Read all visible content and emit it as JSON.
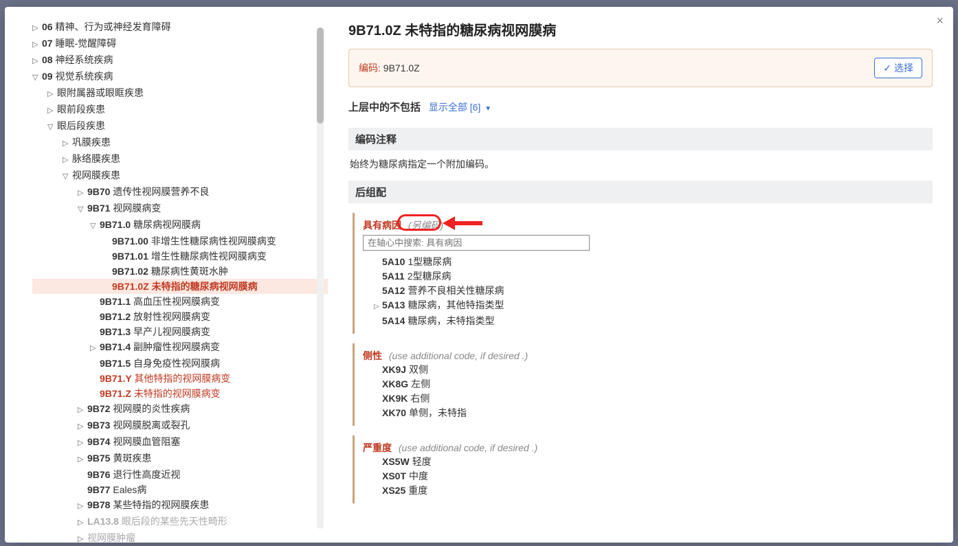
{
  "close_icon": "×",
  "tree": [
    {
      "indent": 0,
      "toggle": "▷",
      "code": "06",
      "text": "精神、行为或神经发育障碍"
    },
    {
      "indent": 0,
      "toggle": "▷",
      "code": "07",
      "text": "睡眠-觉醒障碍"
    },
    {
      "indent": 0,
      "toggle": "▷",
      "code": "08",
      "text": "神经系统疾病"
    },
    {
      "indent": 0,
      "toggle": "▽",
      "code": "09",
      "text": "视觉系统疾病"
    },
    {
      "indent": 1,
      "toggle": "▷",
      "code": "",
      "text": "眼附属器或眼眶疾患"
    },
    {
      "indent": 1,
      "toggle": "▷",
      "code": "",
      "text": "眼前段疾患"
    },
    {
      "indent": 1,
      "toggle": "▽",
      "code": "",
      "text": "眼后段疾患"
    },
    {
      "indent": 2,
      "toggle": "▷",
      "code": "",
      "text": "巩膜疾患"
    },
    {
      "indent": 2,
      "toggle": "▷",
      "code": "",
      "text": "脉络膜疾患"
    },
    {
      "indent": 2,
      "toggle": "▽",
      "code": "",
      "text": "视网膜疾患"
    },
    {
      "indent": 3,
      "toggle": "▷",
      "code": "9B70",
      "text": "遗传性视网膜营养不良"
    },
    {
      "indent": 3,
      "toggle": "▽",
      "code": "9B71",
      "text": "视网膜病变"
    },
    {
      "indent": 4,
      "toggle": "▽",
      "code": "9B71.0",
      "text": "糖尿病视网膜病"
    },
    {
      "indent": 5,
      "toggle": "",
      "code": "9B71.00",
      "text": "非增生性糖尿病性视网膜病变"
    },
    {
      "indent": 5,
      "toggle": "",
      "code": "9B71.01",
      "text": "增生性糖尿病性视网膜病变"
    },
    {
      "indent": 5,
      "toggle": "",
      "code": "9B71.02",
      "text": "糖尿病性黄斑水肿"
    },
    {
      "indent": 5,
      "toggle": "",
      "code": "9B71.0Z",
      "text": "未特指的糖尿病视网膜病",
      "selected": true
    },
    {
      "indent": 4,
      "toggle": "",
      "code": "9B71.1",
      "text": "高血压性视网膜病变"
    },
    {
      "indent": 4,
      "toggle": "",
      "code": "9B71.2",
      "text": "放射性视网膜病变"
    },
    {
      "indent": 4,
      "toggle": "",
      "code": "9B71.3",
      "text": "早产儿视网膜病变"
    },
    {
      "indent": 4,
      "toggle": "▷",
      "code": "9B71.4",
      "text": "副肿瘤性视网膜病变"
    },
    {
      "indent": 4,
      "toggle": "",
      "code": "9B71.5",
      "text": "自身免疫性视网膜病"
    },
    {
      "indent": 4,
      "toggle": "",
      "code": "9B71.Y",
      "text": "其他特指的视网膜病变",
      "highlighted": true
    },
    {
      "indent": 4,
      "toggle": "",
      "code": "9B71.Z",
      "text": "未特指的视网膜病变",
      "highlighted": true
    },
    {
      "indent": 3,
      "toggle": "▷",
      "code": "9B72",
      "text": "视网膜的炎性疾病"
    },
    {
      "indent": 3,
      "toggle": "▷",
      "code": "9B73",
      "text": "视网膜脱离或裂孔"
    },
    {
      "indent": 3,
      "toggle": "▷",
      "code": "9B74",
      "text": "视网膜血管阻塞"
    },
    {
      "indent": 3,
      "toggle": "▷",
      "code": "9B75",
      "text": "黄斑疾患"
    },
    {
      "indent": 3,
      "toggle": "",
      "code": "9B76",
      "text": "退行性高度近视"
    },
    {
      "indent": 3,
      "toggle": "",
      "code": "9B77",
      "text": "Eales病"
    },
    {
      "indent": 3,
      "toggle": "▷",
      "code": "9B78",
      "text": "某些特指的视网膜疾患"
    },
    {
      "indent": 3,
      "toggle": "▷",
      "code": "LA13.8",
      "text": "眼后段的某些先天性畸形",
      "disabled": true
    },
    {
      "indent": 3,
      "toggle": "▷",
      "code": "",
      "text": "视网膜肿瘤",
      "disabled": true
    }
  ],
  "detail": {
    "title": "9B71.0Z 未特指的糖尿病视网膜病",
    "code_label": "编码:",
    "code_value": "9B71.0Z",
    "select_btn": "选择",
    "excludes_label": "上层中的不包括",
    "show_all": "显示全部 [6]",
    "coding_note_header": "编码注释",
    "coding_note_text": "始终为糖尿病指定一个附加编码。",
    "postcoord_header": "后组配",
    "axes": [
      {
        "label": "具有病因",
        "note": "(另编码)",
        "highlight": true,
        "search_placeholder": "在轴心中搜索: 具有病因",
        "items": [
          {
            "toggle": "",
            "code": "5A10",
            "text": "1型糖尿病"
          },
          {
            "toggle": "",
            "code": "5A11",
            "text": "2型糖尿病"
          },
          {
            "toggle": "",
            "code": "5A12",
            "text": "营养不良相关性糖尿病"
          },
          {
            "toggle": "▷",
            "code": "5A13",
            "text": "糖尿病，其他特指类型"
          },
          {
            "toggle": "",
            "code": "5A14",
            "text": "糖尿病，未特指类型"
          }
        ]
      },
      {
        "label": "侧性",
        "note": "(use additional code, if desired .)",
        "items": [
          {
            "code": "XK9J",
            "text": "双侧"
          },
          {
            "code": "XK8G",
            "text": "左侧"
          },
          {
            "code": "XK9K",
            "text": "右侧"
          },
          {
            "code": "XK70",
            "text": "单侧，未特指"
          }
        ]
      },
      {
        "label": "严重度",
        "note": "(use additional code, if desired .)",
        "items": [
          {
            "code": "XS5W",
            "text": "轻度"
          },
          {
            "code": "XS0T",
            "text": "中度"
          },
          {
            "code": "XS25",
            "text": "重度"
          }
        ]
      }
    ]
  }
}
